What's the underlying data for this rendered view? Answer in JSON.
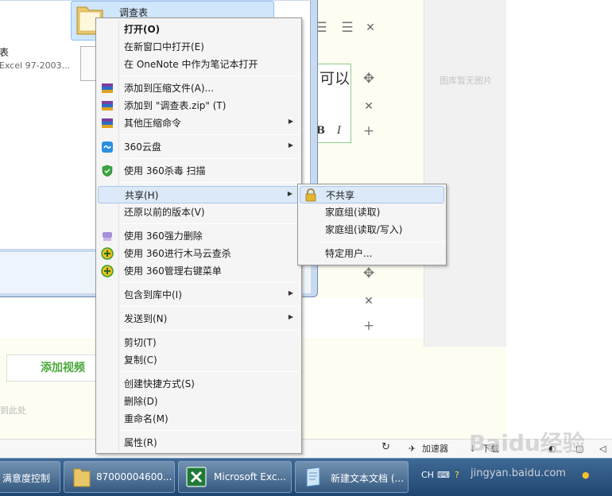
{
  "explorer": {
    "selected_file": "调查表",
    "file2_name": "表",
    "file2_type": "Excel 97-2003..."
  },
  "editor": {
    "box_text": "可以",
    "bold_label": "B",
    "italic_label": "I",
    "gallery_empty": "图库暂无图片",
    "add_video": "添加视频",
    "drop_hint": "到此处"
  },
  "statusbar": {
    "accelerator": "加速器",
    "download": "下载"
  },
  "context_menu": {
    "items": [
      {
        "label": "打开(O)"
      },
      {
        "label": "在新窗口中打开(E)"
      },
      {
        "label": "在 OneNote 中作为笔记本打开"
      },
      {
        "label": "添加到压缩文件(A)..."
      },
      {
        "label": "添加到 \"调查表.zip\" (T)"
      },
      {
        "label": "其他压缩命令"
      },
      {
        "label": "360云盘"
      },
      {
        "label": "使用 360杀毒 扫描"
      },
      {
        "label": "共享(H)"
      },
      {
        "label": "还原以前的版本(V)"
      },
      {
        "label": "使用 360强力删除"
      },
      {
        "label": "使用 360进行木马云查杀"
      },
      {
        "label": "使用 360管理右键菜单"
      },
      {
        "label": "包含到库中(I)"
      },
      {
        "label": "发送到(N)"
      },
      {
        "label": "剪切(T)"
      },
      {
        "label": "复制(C)"
      },
      {
        "label": "创建快捷方式(S)"
      },
      {
        "label": "删除(D)"
      },
      {
        "label": "重命名(M)"
      },
      {
        "label": "属性(R)"
      }
    ]
  },
  "share_submenu": {
    "items": [
      {
        "label": "不共享"
      },
      {
        "label": "家庭组(读取)"
      },
      {
        "label": "家庭组(读取/写入)"
      },
      {
        "label": "特定用户..."
      }
    ]
  },
  "taskbar": {
    "buttons": [
      {
        "label": "满意度控制"
      },
      {
        "label": "87000004600..."
      },
      {
        "label": "Microsoft Exc..."
      },
      {
        "label": "新建文本文档 (..."
      }
    ],
    "tray_lang": "CH"
  },
  "watermark": {
    "brand": "Baidu经验",
    "url": "jingyan.baidu.com"
  },
  "colors": {
    "menu_highlight": "#dce9f8",
    "taskbar": "#2b5582",
    "add_video_green": "#4aa83a"
  }
}
